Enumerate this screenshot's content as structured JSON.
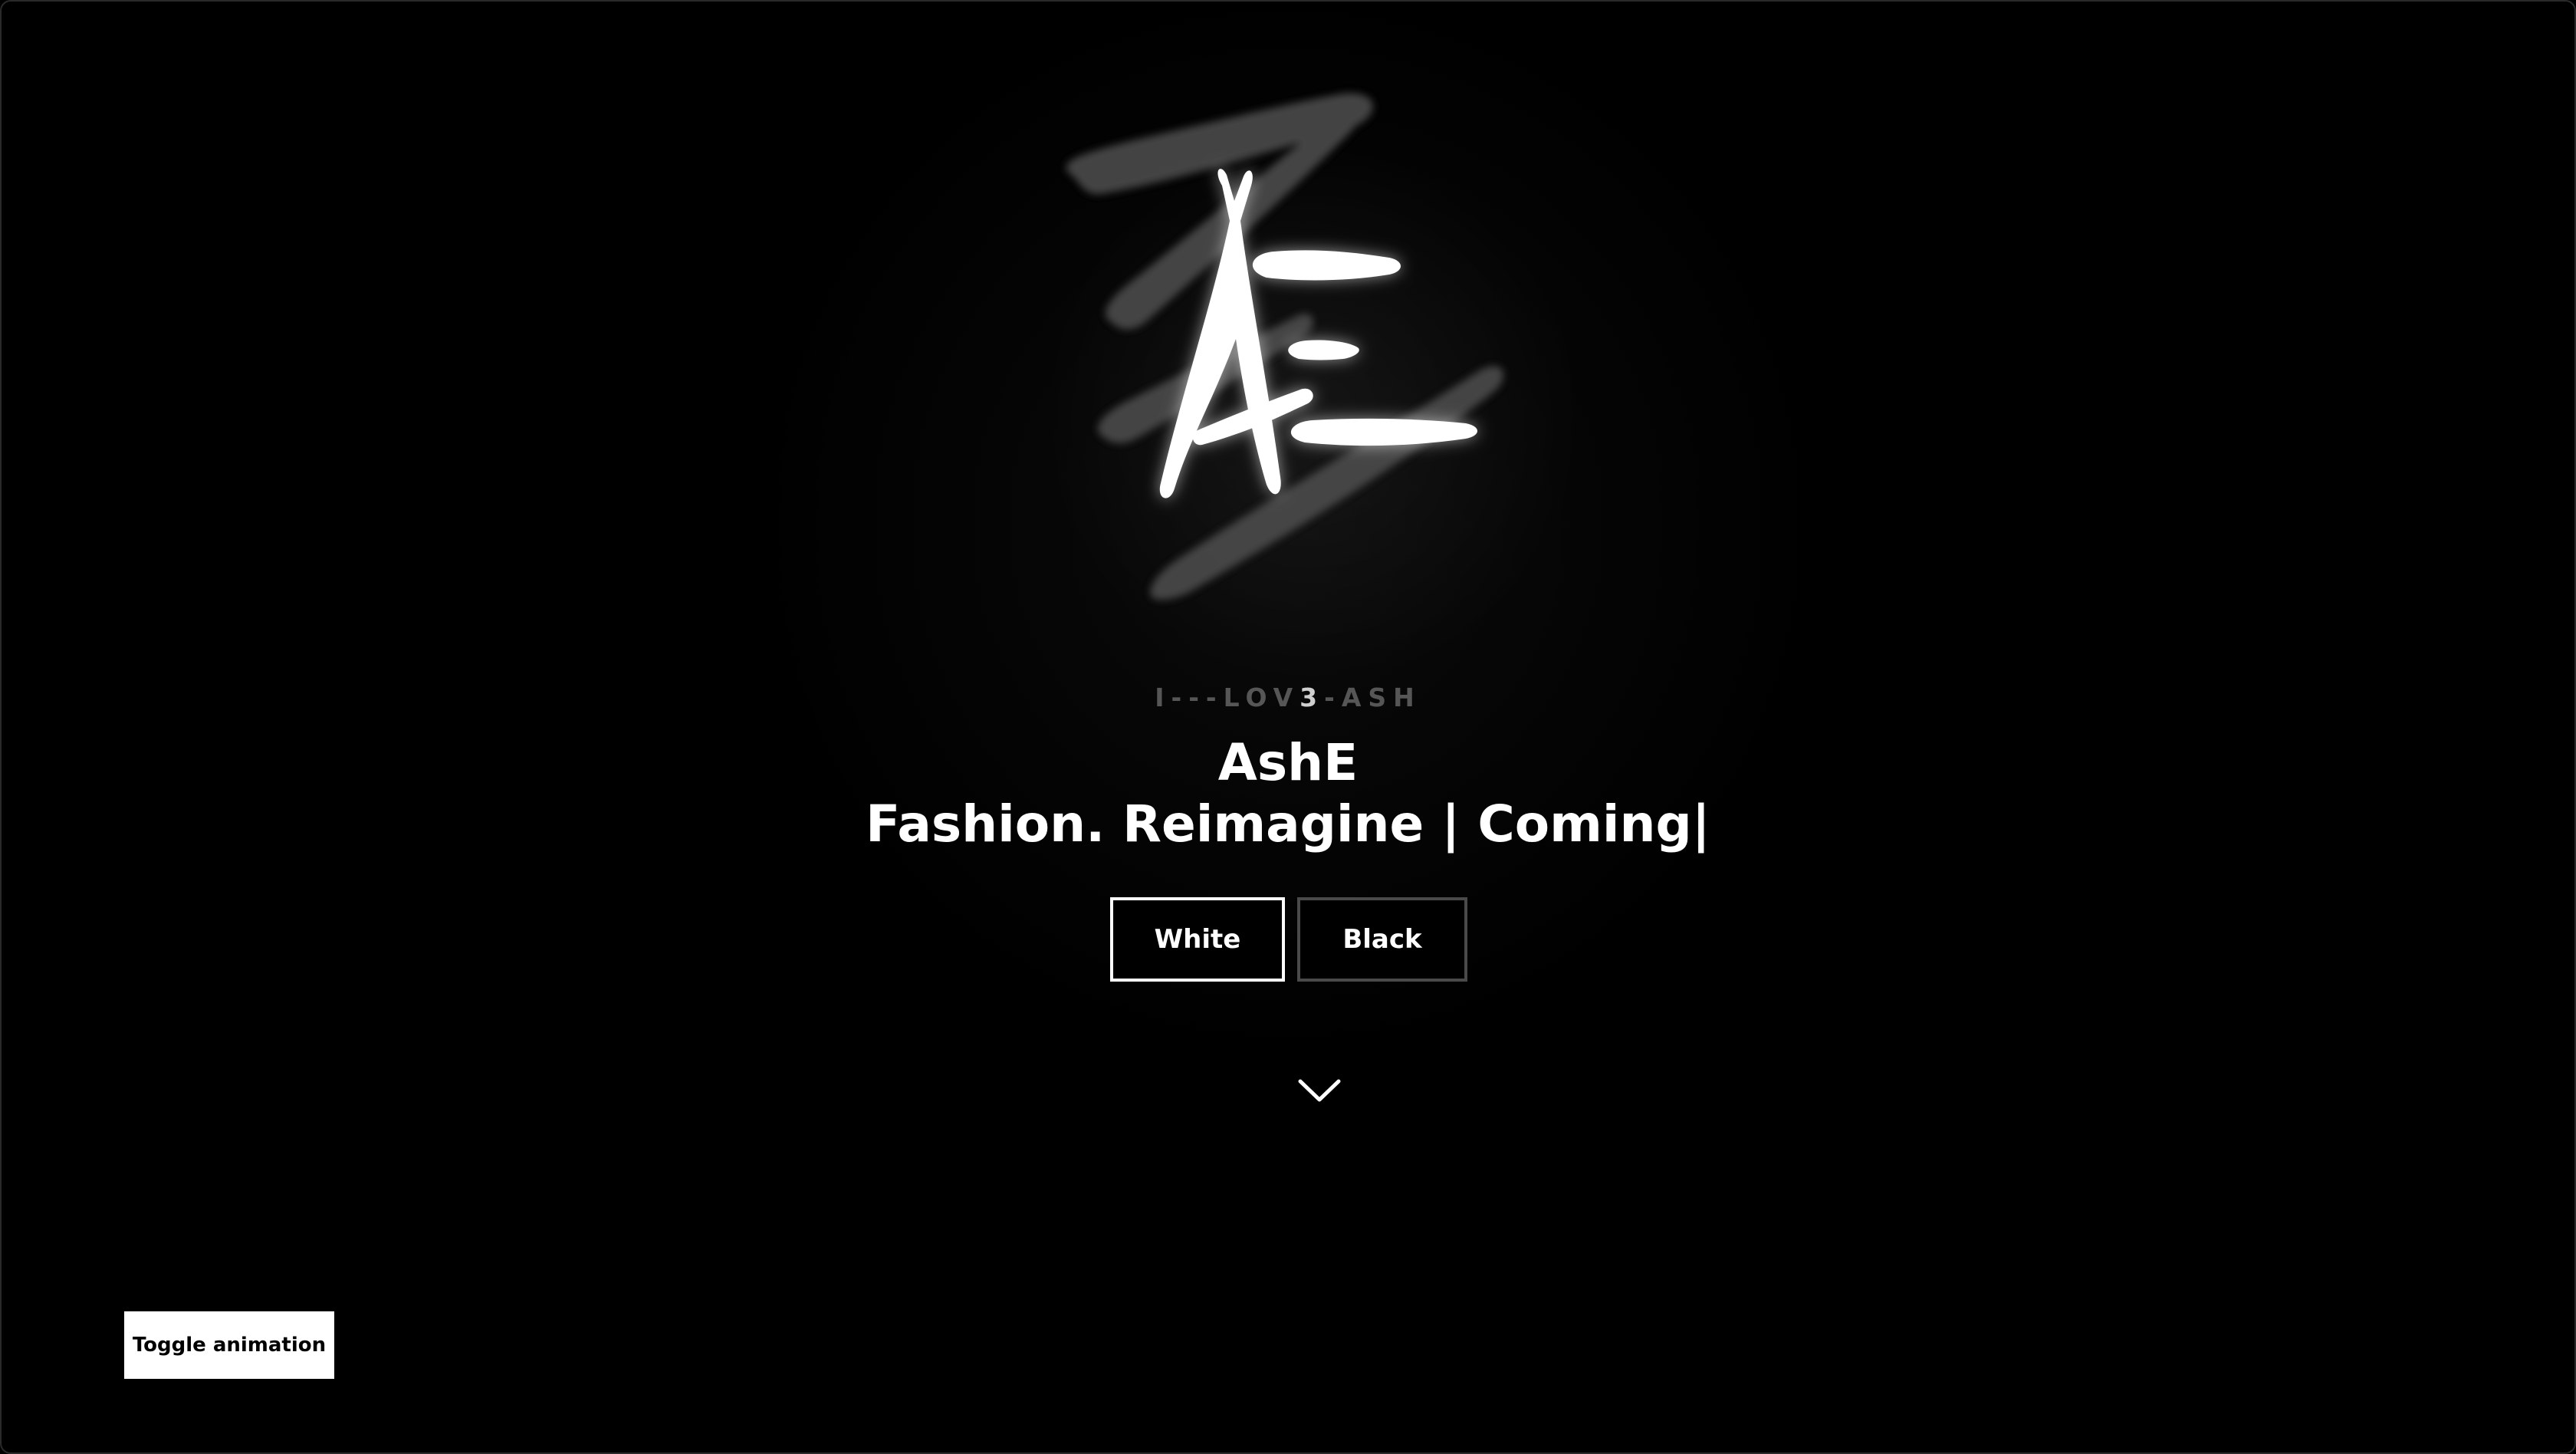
{
  "hero": {
    "logo_icon": "ashe-brush-logo",
    "tagline_prefix": "I---LOV",
    "tagline_highlight": "3",
    "tagline_suffix": "-ASH",
    "brand": "AshE",
    "headline": "Fashion. Reimagine | Coming|"
  },
  "theme_buttons": {
    "white_label": "White",
    "black_label": "Black"
  },
  "scroll": {
    "icon": "chevron-down-icon"
  },
  "controls": {
    "toggle_label": "Toggle animation"
  },
  "colors": {
    "background": "#000000",
    "foreground": "#ffffff",
    "tagline_dim": "#565656",
    "inactive_border": "#4a4a4a"
  }
}
